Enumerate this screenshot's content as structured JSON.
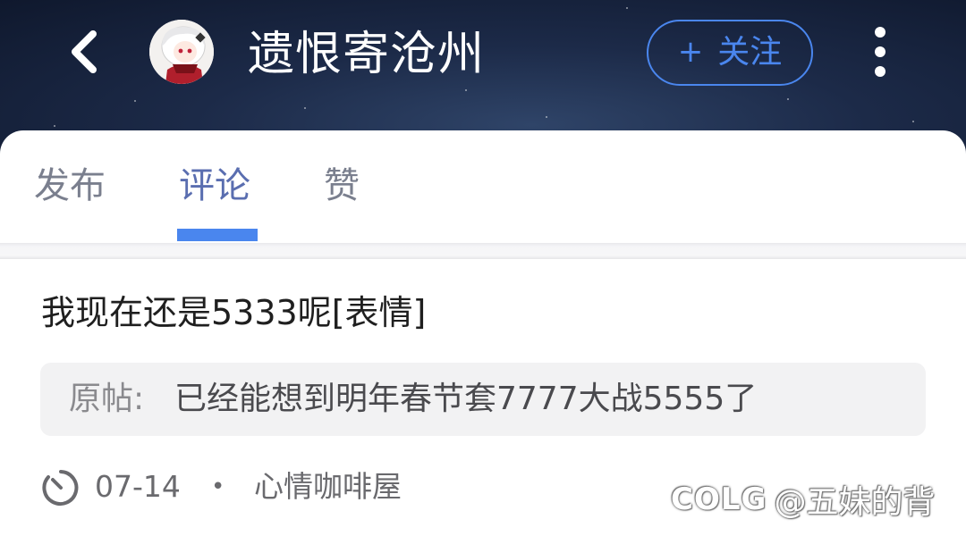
{
  "header": {
    "username": "遗恨寄沧州",
    "follow_button": {
      "plus": "+",
      "label": "关注"
    },
    "back_icon": "chevron-left-icon",
    "more_icon": "more-vertical-icon",
    "colors": {
      "follow_accent": "#4a86ee",
      "header_background": "#1c2a48"
    }
  },
  "tabs": [
    {
      "label": "发布",
      "active": false
    },
    {
      "label": "评论",
      "active": true
    },
    {
      "label": "赞",
      "active": false
    }
  ],
  "active_tab_color": "#5a6eb0",
  "comment": {
    "text": "我现在还是5333呢[表情]",
    "quote": {
      "label": "原帖:",
      "text": "已经能想到明年春节套7777大战5555了"
    },
    "meta": {
      "clock_icon": "clock-icon",
      "date": "07-14",
      "separator": "•",
      "board": "心情咖啡屋"
    }
  },
  "watermark": {
    "logo": "COLG",
    "text": "@五妹的背"
  }
}
